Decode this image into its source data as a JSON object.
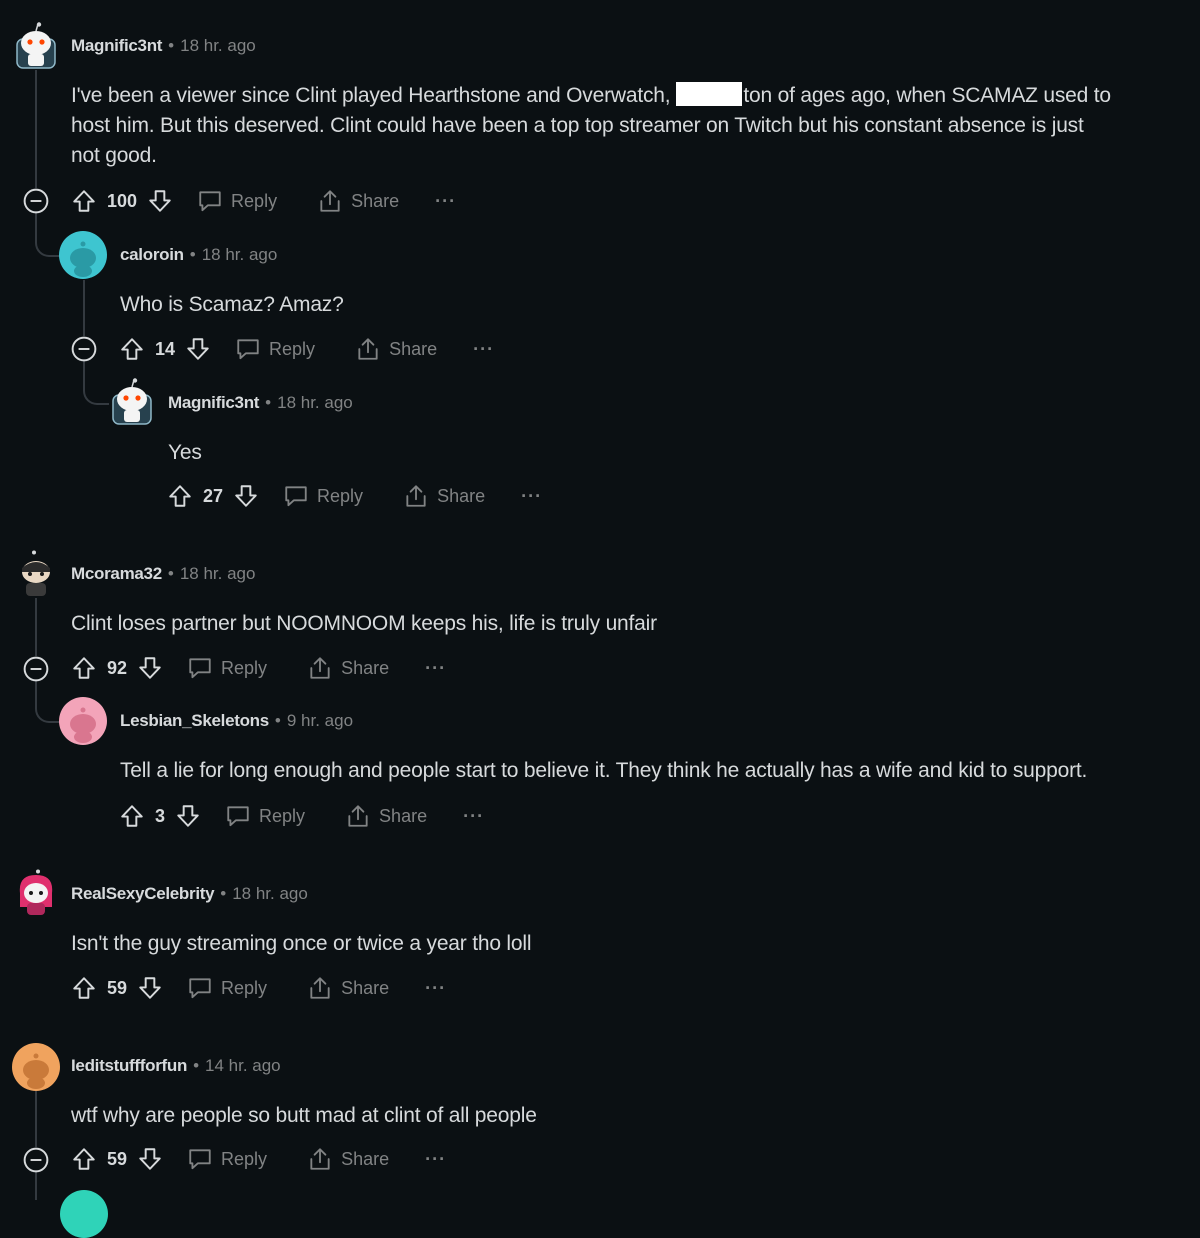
{
  "ui": {
    "reply_label": "Reply",
    "share_label": "Share",
    "more_label": "···",
    "separator": "•"
  },
  "comments": [
    {
      "username": "Magnific3nt",
      "time": "18 hr. ago",
      "lines": [
        "I've been a viewer since Clint played Hearthstone and Overwatch,",
        "ton of ages ago, when SCAMAZ used to",
        "host him. But this deserved. Clint could have been a top top streamer on Twitch but his constant absence is just",
        "not good."
      ],
      "score": "100",
      "avatar": "snoo-ghost-avatar"
    },
    {
      "username": "caloroin",
      "time": "18 hr. ago",
      "lines": [
        "Who is Scamaz? Amaz?"
      ],
      "score": "14",
      "avatar": "default-teal-avatar"
    },
    {
      "username": "Magnific3nt",
      "time": "18 hr. ago",
      "lines": [
        "Yes"
      ],
      "score": "27",
      "avatar": "snoo-ghost-avatar"
    },
    {
      "username": "Mcorama32",
      "time": "18 hr. ago",
      "lines": [
        "Clint loses partner but NOOMNOOM keeps his, life is truly unfair"
      ],
      "score": "92",
      "avatar": "snoo-ninja-avatar"
    },
    {
      "username": "Lesbian_Skeletons",
      "time": "9 hr. ago",
      "lines": [
        "Tell a lie for long enough and people start to believe it. They think he actually has a wife and kid to support."
      ],
      "score": "3",
      "avatar": "default-pink-avatar"
    },
    {
      "username": "RealSexyCelebrity",
      "time": "18 hr. ago",
      "lines": [
        "Isn't the guy streaming once or twice a year tho loll"
      ],
      "score": "59",
      "avatar": "snoo-pink-hair-avatar"
    },
    {
      "username": "Ieditstuffforfun",
      "time": "14 hr. ago",
      "lines": [
        "wtf why are people so butt mad at clint of all people"
      ],
      "score": "59",
      "avatar": "default-orange-avatar"
    }
  ],
  "colors": {
    "background": "#0b1013",
    "text": "#d7dadc",
    "muted": "#818384",
    "thread": "#343a40",
    "teal": "#3ec5d0",
    "pink": "#f3a4b9",
    "orange": "#f0a35e"
  }
}
